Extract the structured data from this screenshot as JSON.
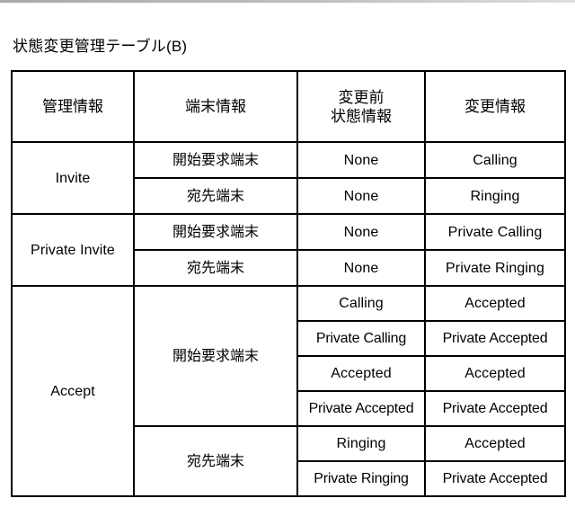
{
  "figure": {
    "title": "状態変更管理テーブル(B)"
  },
  "table": {
    "headers": {
      "col1": "管理情報",
      "col2": "端末情報",
      "col3": "変更前\n状態情報",
      "col4": "変更情報"
    },
    "groups": [
      {
        "management_info": "Invite",
        "terminals": [
          {
            "terminal_info": "開始要求端末",
            "rows": [
              {
                "before_state": "None",
                "change_info": "Calling"
              }
            ]
          },
          {
            "terminal_info": "宛先端末",
            "rows": [
              {
                "before_state": "None",
                "change_info": "Ringing"
              }
            ]
          }
        ]
      },
      {
        "management_info": "Private Invite",
        "terminals": [
          {
            "terminal_info": "開始要求端末",
            "rows": [
              {
                "before_state": "None",
                "change_info": "Private Calling"
              }
            ]
          },
          {
            "terminal_info": "宛先端末",
            "rows": [
              {
                "before_state": "None",
                "change_info": "Private Ringing"
              }
            ]
          }
        ]
      },
      {
        "management_info": "Accept",
        "terminals": [
          {
            "terminal_info": "開始要求端末",
            "rows": [
              {
                "before_state": "Calling",
                "change_info": "Accepted"
              },
              {
                "before_state": "Private Calling",
                "change_info": "Private Accepted"
              },
              {
                "before_state": "Accepted",
                "change_info": "Accepted"
              },
              {
                "before_state": "Private Accepted",
                "change_info": "Private Accepted"
              }
            ]
          },
          {
            "terminal_info": "宛先端末",
            "rows": [
              {
                "before_state": "Ringing",
                "change_info": "Accepted"
              },
              {
                "before_state": "Private Ringing",
                "change_info": "Private Accepted"
              }
            ]
          }
        ]
      }
    ]
  }
}
